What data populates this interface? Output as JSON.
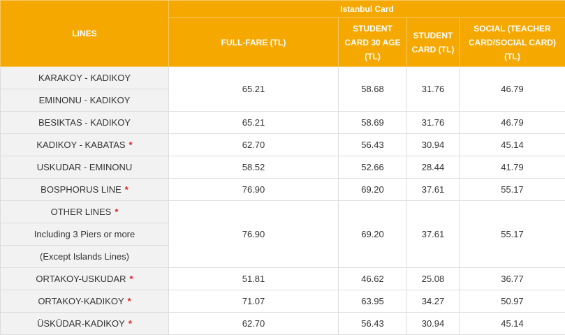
{
  "header": {
    "lines": "LINES",
    "group": "Istanbul Card",
    "cols": [
      "FULL-FARE (TL)",
      "STUDENT CARD 30 AGE (TL)",
      "STUDENT CARD (TL)",
      "SOCIAL (TEACHER CARD/SOCIAL CARD) (TL)"
    ]
  },
  "star": "*",
  "lines": [
    "KARAKOY - KADIKOY",
    "EMINONU - KADIKOY",
    "BESIKTAS - KADIKOY",
    "KADIKOY - KABATAS",
    "USKUDAR - EMINONU",
    "BOSPHORUS LINE",
    "OTHER LINES",
    "Including 3 Piers or more",
    "(Except Islands Lines)",
    "ORTAKOY-USKUDAR",
    "ORTAKOY-KADIKOY",
    "ÜSKÜDAR-KADIKOY"
  ],
  "prices": [
    [
      "65.21",
      "58.68",
      "31.76",
      "46.79"
    ],
    [
      "65.21",
      "58.69",
      "31.76",
      "46.79"
    ],
    [
      "62.70",
      "56.43",
      "30.94",
      "45.14"
    ],
    [
      "58.52",
      "52.66",
      "28.44",
      "41.79"
    ],
    [
      "76.90",
      "69.20",
      "37.61",
      "55.17"
    ],
    [
      "76.90",
      "69.20",
      "37.61",
      "55.17"
    ],
    [
      "51.81",
      "46.62",
      "25.08",
      "36.77"
    ],
    [
      "71.07",
      "63.95",
      "34.27",
      "50.97"
    ],
    [
      "62.70",
      "56.43",
      "30.94",
      "45.14"
    ]
  ]
}
